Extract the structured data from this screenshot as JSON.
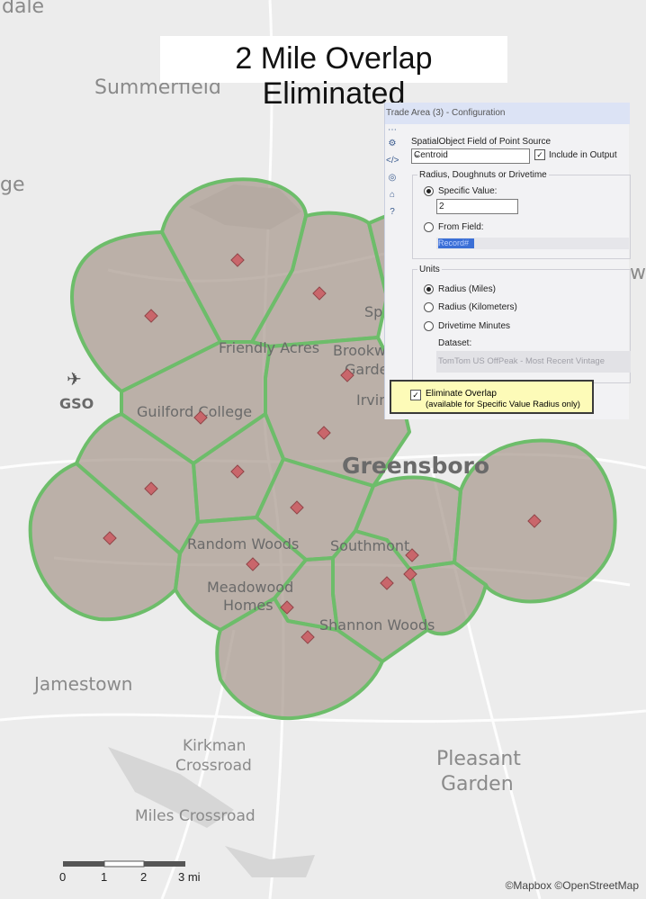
{
  "title": "2 Mile Overlap Eliminated",
  "map": {
    "places": {
      "dale": "dale",
      "summerfield": "Summerfield",
      "ge": "ge",
      "gso": "GSO",
      "friendly_acres": "Friendly Acres",
      "brookwood": "Brookwood",
      "garden": "Garden",
      "irving": "Irvin",
      "sp": "Sp",
      "guilford_college": "Guilford College",
      "greensboro": "Greensboro",
      "random_woods": "Random Woods",
      "southmont": "Southmont",
      "meadowood": "Meadowood",
      "homes": "Homes",
      "shannon_woods": "Shannon Woods",
      "jamestown": "Jamestown",
      "kirkman": "Kirkman",
      "crossroad": "Crossroad",
      "pleasant": "Pleasant",
      "garden2": "Garden",
      "miles_crossroad": "Miles Crossroad",
      "w": "w"
    },
    "colors": {
      "trade_fill": "#a8998d",
      "trade_stroke": "#6dbd6a",
      "point": "#c9666b",
      "background": "#ececec"
    },
    "scale": {
      "labels": [
        "0",
        "1",
        "2",
        "3 mi"
      ]
    },
    "attribution": "©Mapbox ©OpenStreetMap"
  },
  "config": {
    "header": "Trade Area (3) - Configuration",
    "toolbar_icons": [
      "more-icon",
      "gear-icon",
      "code-icon",
      "target-icon",
      "tag-icon",
      "help-icon"
    ],
    "spatial_label": "SpatialObject Field of Point Source",
    "spatial_value": "Centroid",
    "include_output": "Include in Output",
    "radius_group": "Radius, Doughnuts or Drivetime",
    "specific_value_label": "Specific Value:",
    "specific_value": "2",
    "from_field_label": "From Field:",
    "from_field_value": "Record#",
    "units_group": "Units",
    "unit_miles": "Radius (Miles)",
    "unit_km": "Radius (Kilometers)",
    "unit_drive": "Drivetime Minutes",
    "dataset_label": "Dataset:",
    "dataset_value": "TomTom US OffPeak - Most Recent Vintage",
    "eliminate_overlap": "Eliminate Overlap",
    "eliminate_note": "(available for Specific Value Radius only)"
  }
}
